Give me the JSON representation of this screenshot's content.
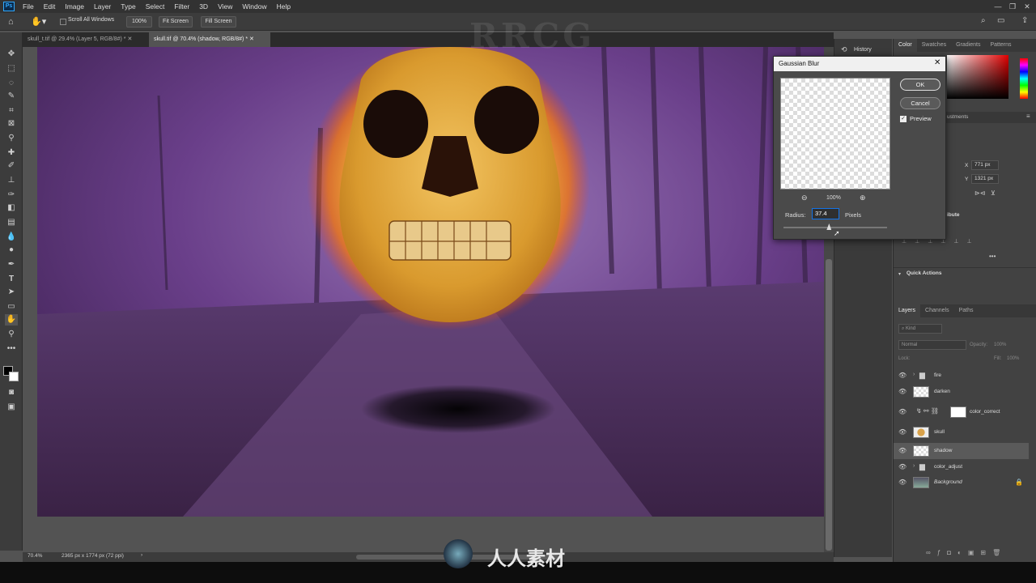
{
  "app": {
    "icon": "Ps"
  },
  "menu": [
    "File",
    "Edit",
    "Image",
    "Layer",
    "Type",
    "Select",
    "Filter",
    "3D",
    "View",
    "Window",
    "Help"
  ],
  "options": {
    "scroll_all": "Scroll All Windows",
    "zoom_btn": "100%",
    "fit_btn": "Fit Screen",
    "fill_btn": "Fill Screen"
  },
  "tabs": [
    {
      "label": "skull_t.tif @ 29.4% (Layer 5, RGB/8#) *"
    },
    {
      "label": "skull.tif @ 70.4% (shadow, RGB/8#) *"
    }
  ],
  "status": {
    "zoom": "70.4%",
    "doc": "2365 px x 1774 px (72 ppi)"
  },
  "panel_strip": {
    "history": "History"
  },
  "color_tabs": [
    "Color",
    "Swatches",
    "Gradients",
    "Patterns"
  ],
  "properties": {
    "adjustments_label": "ustments",
    "x_label": "X",
    "x_value": "771 px",
    "y_label": "Y",
    "y_value": "1321 px",
    "attribute_label": "ibute",
    "quick_actions": "Quick Actions"
  },
  "layers_tabs": [
    "Layers",
    "Channels",
    "Paths"
  ],
  "layers_kind": "Kind",
  "layers_blend": "Normal",
  "layers_opacity": "Opacity:",
  "layers_opacity_val": "100%",
  "layers_lock": "Lock:",
  "layers_fill": "Fill:",
  "layers_fill_val": "100%",
  "layers": [
    {
      "name": "fire",
      "type": "group"
    },
    {
      "name": "darken",
      "type": "layer"
    },
    {
      "name": "color_correct",
      "type": "adjustment"
    },
    {
      "name": "skull",
      "type": "layer"
    },
    {
      "name": "shadow",
      "type": "layer",
      "selected": true
    },
    {
      "name": "color_adjust",
      "type": "group"
    },
    {
      "name": "Background",
      "type": "background"
    }
  ],
  "dialog": {
    "title": "Gaussian Blur",
    "ok": "OK",
    "cancel": "Cancel",
    "preview": "Preview",
    "zoom": "100%",
    "radius_label": "Radius:",
    "radius_value": "37.4",
    "radius_unit": "Pixels",
    "slider_level": 0.44
  },
  "watermark": {
    "text": "RRCG",
    "cn": "人人素材"
  },
  "colors": {
    "canvas_purple": "#5b3574",
    "fire": "#f5a321",
    "accent": "#1473e6"
  }
}
